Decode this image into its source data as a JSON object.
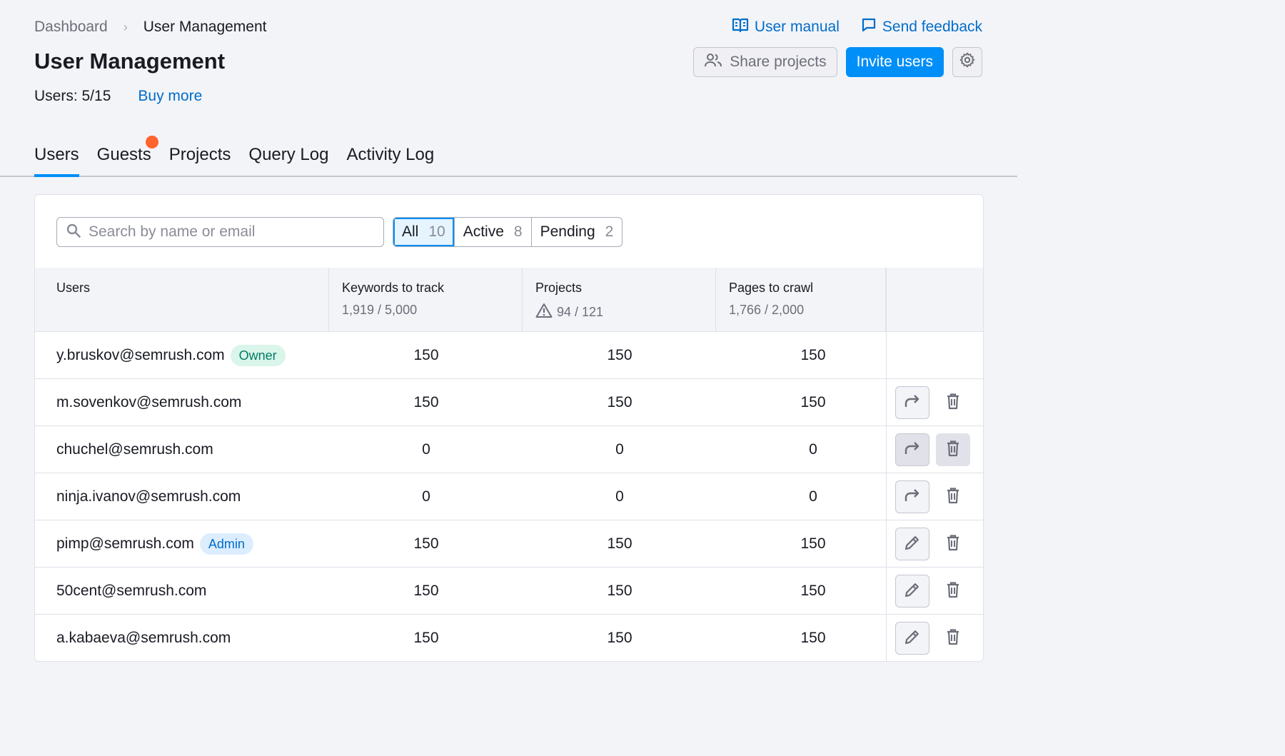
{
  "breadcrumb": {
    "parent": "Dashboard",
    "separator": "›",
    "current": "User Management"
  },
  "top_links": {
    "manual": "User manual",
    "feedback": "Send feedback"
  },
  "title": "User Management",
  "actions": {
    "share": "Share projects",
    "invite": "Invite users",
    "settings_icon": "gear-icon"
  },
  "users_summary": {
    "label": "Users: 5/15",
    "buy_more": "Buy more"
  },
  "tabs": [
    {
      "label": "Users",
      "active": true
    },
    {
      "label": "Guests",
      "notification": true
    },
    {
      "label": "Projects"
    },
    {
      "label": "Query Log"
    },
    {
      "label": "Activity Log"
    }
  ],
  "search": {
    "placeholder": "Search by name or email",
    "value": ""
  },
  "filters": [
    {
      "label": "All",
      "count": "10",
      "active": true
    },
    {
      "label": "Active",
      "count": "8"
    },
    {
      "label": "Pending",
      "count": "2"
    }
  ],
  "columns": {
    "users": {
      "title": "Users"
    },
    "keywords": {
      "title": "Keywords to track",
      "sub": "1,919 / 5,000"
    },
    "projects": {
      "title": "Projects",
      "sub": "94 / 121",
      "warning_icon": "warning-icon"
    },
    "pages": {
      "title": "Pages to crawl",
      "sub": "1,766 / 2,000"
    }
  },
  "rows": [
    {
      "email": "y.bruskov@semrush.com",
      "badge": "Owner",
      "keywords": "150",
      "projects": "150",
      "pages": "150"
    },
    {
      "email": "m.sovenkov@semrush.com",
      "keywords": "150",
      "projects": "150",
      "pages": "150"
    },
    {
      "email": "chuchel@semrush.com",
      "keywords": "0",
      "projects": "0",
      "pages": "0"
    },
    {
      "email": "ninja.ivanov@semrush.com",
      "keywords": "0",
      "projects": "0",
      "pages": "0"
    },
    {
      "email": "pimp@semrush.com",
      "badge": "Admin",
      "keywords": "150",
      "projects": "150",
      "pages": "150"
    },
    {
      "email": "50cent@semrush.com",
      "keywords": "150",
      "projects": "150",
      "pages": "150"
    },
    {
      "email": "a.kabaeva@semrush.com",
      "keywords": "150",
      "projects": "150",
      "pages": "150"
    }
  ],
  "colors": {
    "primary": "#008ff8",
    "link": "#006dca",
    "notification": "#ff642d"
  }
}
